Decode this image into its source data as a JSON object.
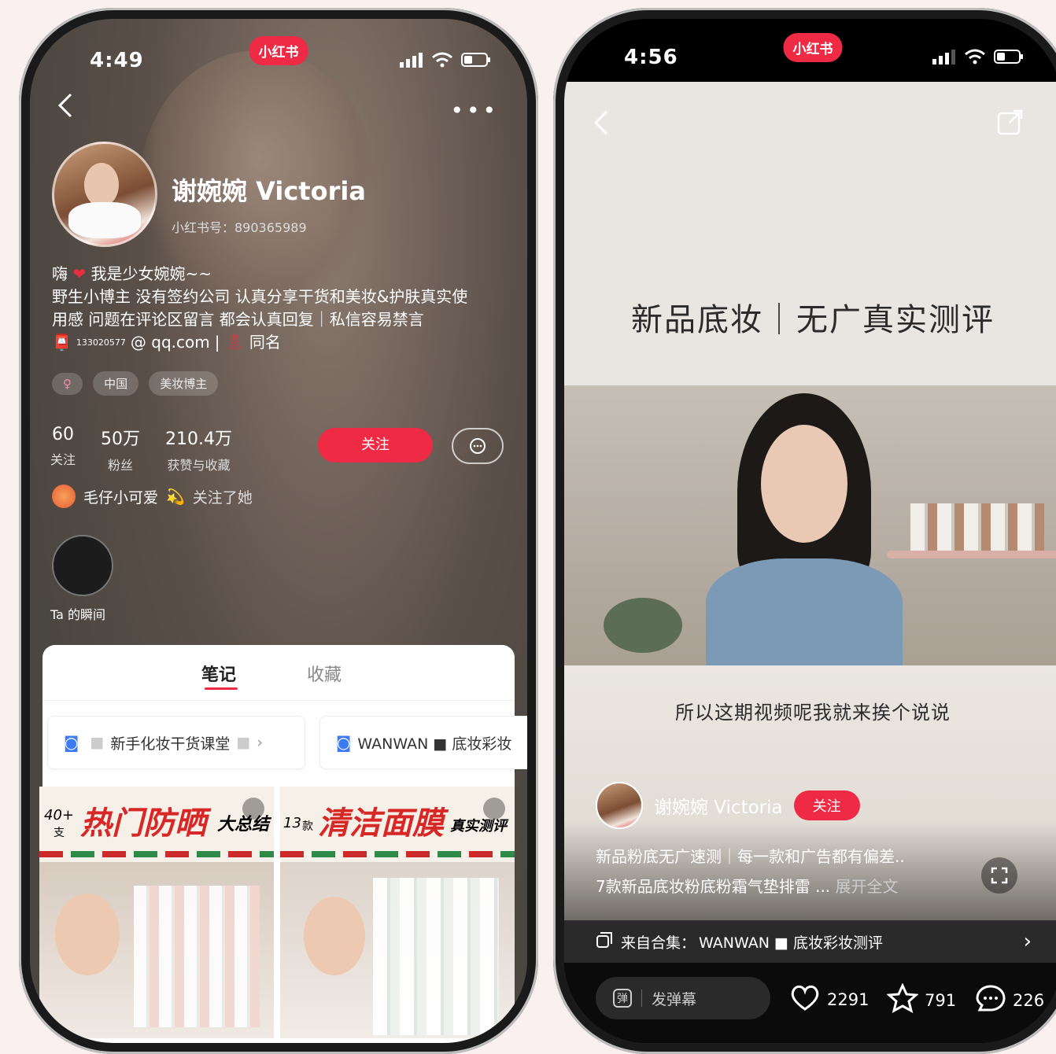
{
  "left_phone": {
    "status": {
      "time": "4:49"
    },
    "brand": "小红书",
    "profile": {
      "name": "谢婉婉 Victoria",
      "id_label": "小红书号：890365989",
      "bio_line1_a": "嗨",
      "bio_line1_b": "我是少女婉婉~~",
      "bio_line2": "野生小博主 没有签约公司 认真分享干货和美妆&护肤真实使",
      "bio_line3": "用感 问题在评论区留言 都会认真回复｜私信容易禁言",
      "contact_number": "133020577",
      "contact_domain": "@ qq.com",
      "contact_divider": "|",
      "contact_same": "同名",
      "tags": [
        "♀",
        "中国",
        "美妆博主"
      ],
      "stats": [
        {
          "num": "60",
          "label": "关注"
        },
        {
          "num": "50万",
          "label": "粉丝"
        },
        {
          "num": "210.4万",
          "label": "获赞与收藏"
        }
      ],
      "follow_label": "关注",
      "followed_by_name": "毛仔小可爱",
      "followed_by_suffix": "关注了她",
      "moments_label": "Ta 的瞬间"
    },
    "tabs": {
      "notes": "笔记",
      "collections": "收藏"
    },
    "collections": [
      {
        "label": "新手化妆干货课堂"
      },
      {
        "label": "WANWAN ■ 底妆彩妆"
      }
    ],
    "cards": [
      {
        "num": "40+",
        "unit": "支",
        "title": "热门防晒",
        "suffix": "大总结"
      },
      {
        "num": "13",
        "unit": "款",
        "title": "清洁面膜",
        "suffix": "真实测评"
      }
    ]
  },
  "right_phone": {
    "status": {
      "time": "4:56"
    },
    "brand": "小红书",
    "video": {
      "title": "新品底妆｜无广真实测评",
      "subtitle": "所以这期视频呢我就来挨个说说",
      "author": "谢婉婉 Victoria",
      "follow_label": "关注",
      "desc_line1": "新品粉底无广速测｜每一款和广告都有偏差..",
      "desc_line2": "7款新品底妆粉底粉霜气垫排雷 ...",
      "expand": "展开全文",
      "collection_prefix": "来自合集：",
      "collection_name": "WANWAN ■ 底妆彩妆测评"
    },
    "bottom": {
      "danmaku_icon": "弹",
      "danmaku_placeholder": "发弹幕",
      "likes": "2291",
      "stars": "791",
      "comments": "226"
    }
  },
  "colors": {
    "accent": "#ee2a45",
    "bg": "#fbf0f0"
  }
}
